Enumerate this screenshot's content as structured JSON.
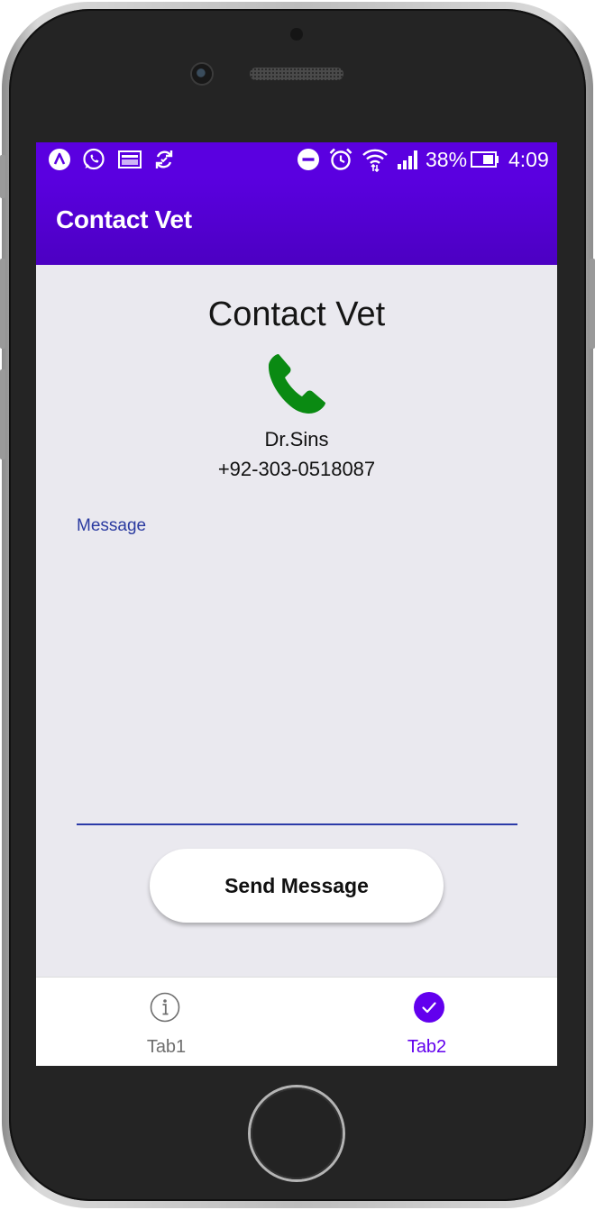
{
  "status_bar": {
    "battery_percent": "38%",
    "time": "4:09",
    "icons": [
      "app-launcher-icon",
      "whatsapp-icon",
      "gallery-icon",
      "sync-icon",
      "do-not-disturb-icon",
      "alarm-icon",
      "wifi-icon",
      "signal-icon",
      "battery-icon"
    ]
  },
  "app_bar": {
    "title": "Contact Vet"
  },
  "main": {
    "heading": "Contact Vet",
    "call_icon": "phone-icon",
    "vet_name": "Dr.Sins",
    "vet_phone": "+92-303-0518087",
    "message_label": "Message",
    "message_value": "",
    "send_button": "Send Message"
  },
  "tabs": [
    {
      "label": "Tab1",
      "icon": "info-icon",
      "active": false
    },
    {
      "label": "Tab2",
      "icon": "check-circle-icon",
      "active": true
    }
  ],
  "colors": {
    "primary": "#5a00e0",
    "background": "#eae9ef",
    "call_green": "#0a8a12",
    "input_accent": "#2b3aa8",
    "tab_inactive": "#6f6f6f"
  }
}
